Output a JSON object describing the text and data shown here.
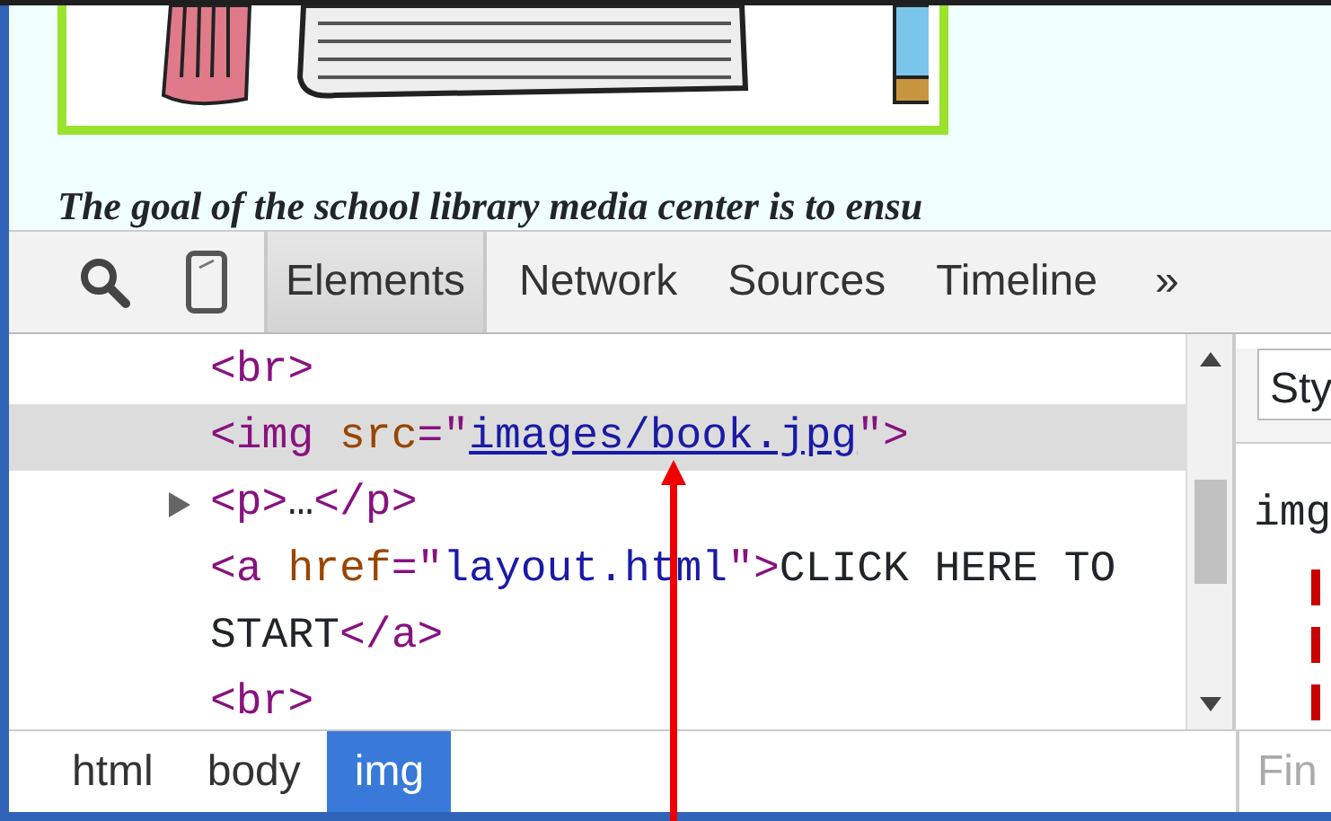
{
  "page": {
    "paragraph": "The goal of the school library media center is to ensu"
  },
  "devtools": {
    "toolbar": {
      "tabs": [
        {
          "label": "Elements",
          "selected": true
        },
        {
          "label": "Network",
          "selected": false
        },
        {
          "label": "Sources",
          "selected": false
        },
        {
          "label": "Timeline",
          "selected": false
        }
      ],
      "overflow": "»"
    },
    "dom_lines": [
      {
        "kind": "leaf",
        "selected": false,
        "tokens": [
          {
            "kind": "tag",
            "text": "<br>"
          }
        ]
      },
      {
        "kind": "leaf",
        "selected": true,
        "tokens": [
          {
            "kind": "tag",
            "text": "<img "
          },
          {
            "kind": "attr",
            "text": "src"
          },
          {
            "kind": "tag",
            "text": "=\""
          },
          {
            "kind": "link",
            "text": "images/book.jpg"
          },
          {
            "kind": "tag",
            "text": "\">"
          }
        ]
      },
      {
        "kind": "parent",
        "selected": false,
        "expanded": false,
        "tokens": [
          {
            "kind": "tag",
            "text": "<p>"
          },
          {
            "kind": "text",
            "text": "…"
          },
          {
            "kind": "tag",
            "text": "</p>"
          }
        ]
      },
      {
        "kind": "leaf",
        "selected": false,
        "tokens": [
          {
            "kind": "tag",
            "text": "<a "
          },
          {
            "kind": "attr",
            "text": "href"
          },
          {
            "kind": "tag",
            "text": "=\""
          },
          {
            "kind": "value",
            "text": "layout.html"
          },
          {
            "kind": "tag",
            "text": "\">"
          },
          {
            "kind": "text",
            "text": "CLICK HERE TO START"
          },
          {
            "kind": "tag",
            "text": "</a>"
          }
        ]
      },
      {
        "kind": "leaf",
        "selected": false,
        "tokens": [
          {
            "kind": "tag",
            "text": "<br>"
          }
        ]
      }
    ],
    "styles": {
      "tab": "Sty",
      "selector": "img"
    },
    "breadcrumbs": [
      {
        "label": "html",
        "selected": false
      },
      {
        "label": "body",
        "selected": false
      },
      {
        "label": "img",
        "selected": true
      }
    ],
    "filter": {
      "placeholder": "Fin"
    }
  }
}
